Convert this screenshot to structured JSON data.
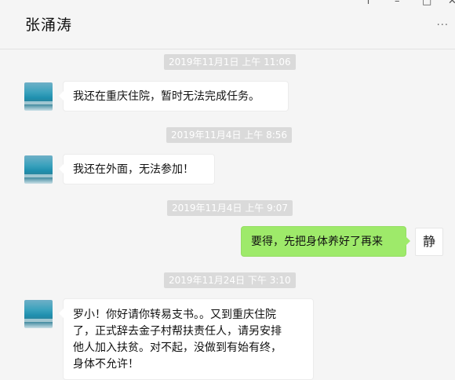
{
  "window": {
    "title": "张涌涛",
    "controls": [
      "〒",
      "–",
      "□",
      "✕"
    ],
    "more": "···"
  },
  "messages": [
    {
      "type": "timestamp",
      "text": "2019年11月1日 上午 11:06"
    },
    {
      "type": "incoming",
      "avatar": "lake-avatar",
      "text": "我还在重庆住院，暂时无法完成任务。"
    },
    {
      "type": "timestamp",
      "text": "2019年11月4日 上午 8:56"
    },
    {
      "type": "incoming",
      "avatar": "lake-avatar",
      "text": "我还在外面，无法参加！"
    },
    {
      "type": "timestamp",
      "text": "2019年11月4日 上午 9:07"
    },
    {
      "type": "outgoing",
      "avatar": "calligraphy-avatar",
      "avatar_glyph": "静",
      "text": "要得，先把身体养好了再来"
    },
    {
      "type": "timestamp",
      "text": "2019年11月24日 下午 3:10"
    },
    {
      "type": "incoming",
      "avatar": "lake-avatar",
      "lines": [
        "罗小！你好请你转易支书。。又到重庆住院",
        "了，正式辞去金子村帮扶责任人，请另安排",
        "他人加入扶贫。对不起，没做到有始有终，",
        "身体不允许！"
      ]
    }
  ],
  "colors": {
    "background": "#f5f5f5",
    "outgoing_bubble": "#9eea6a",
    "incoming_bubble": "#ffffff",
    "timestamp_bg": "#dadada"
  }
}
